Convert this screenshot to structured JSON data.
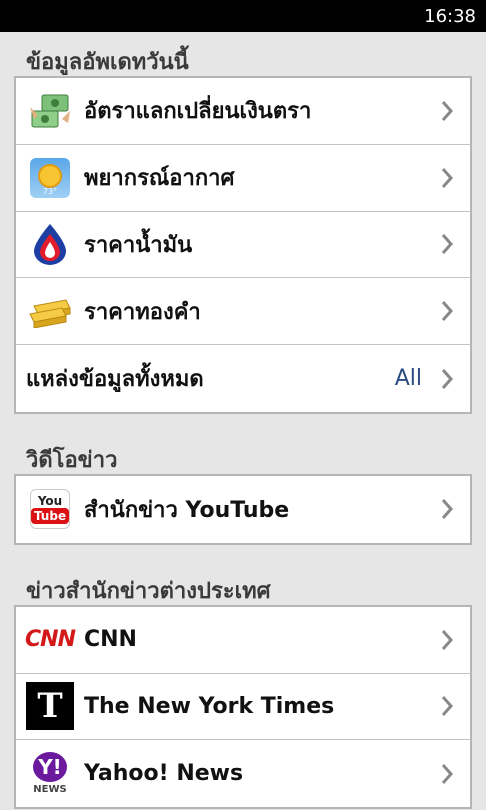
{
  "status_bar": {
    "time": "16:38"
  },
  "sections": {
    "today": {
      "title": "ข้อมูลอัพเดทวันนี้",
      "items": [
        {
          "label": "อัตราแลกเปลี่ยนเงินตรา",
          "icon": "money-exchange-icon"
        },
        {
          "label": "พยากรณ์อากาศ",
          "icon": "weather-icon",
          "temp": "73°"
        },
        {
          "label": "ราคาน้ำมัน",
          "icon": "oil-drop-icon"
        },
        {
          "label": "ราคาทองคำ",
          "icon": "gold-bar-icon"
        },
        {
          "label": "แหล่งข้อมูลทั้งหมด",
          "value": "All"
        }
      ]
    },
    "video": {
      "title": "วิดีโอข่าว",
      "items": [
        {
          "label": "สำนักข่าว YouTube",
          "icon": "youtube-icon",
          "logo_you": "You",
          "logo_tube": "Tube"
        }
      ]
    },
    "foreign": {
      "title": "ข่าวสำนักข่าวต่างประเทศ",
      "items": [
        {
          "label": "CNN",
          "icon": "cnn-logo-icon",
          "logo": "CNN"
        },
        {
          "label": "The New York Times",
          "icon": "nyt-logo-icon",
          "logo": "T"
        },
        {
          "label": "Yahoo! News",
          "icon": "yahoo-logo-icon",
          "logo_y": "Y!",
          "logo_news": "NEWS"
        }
      ]
    }
  },
  "colors": {
    "background": "#e6e6e6",
    "accent_value": "#2a4c82",
    "chevron": "#888888"
  }
}
